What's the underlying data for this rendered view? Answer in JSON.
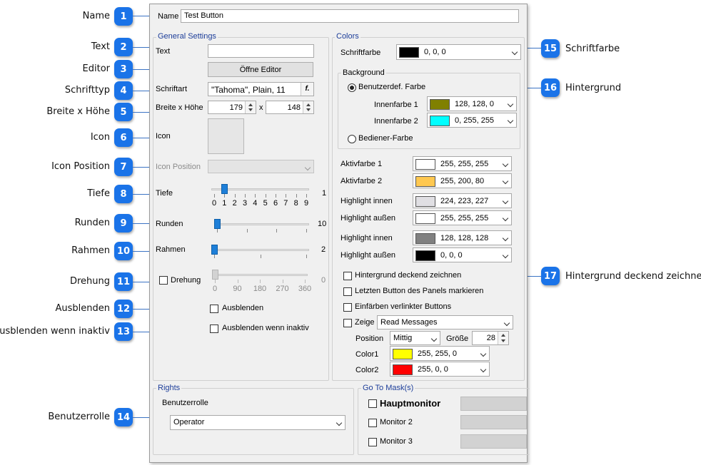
{
  "callouts": [
    {
      "num": "1",
      "label": "Name"
    },
    {
      "num": "2",
      "label": "Text"
    },
    {
      "num": "3",
      "label": "Editor"
    },
    {
      "num": "4",
      "label": "Schrifttyp"
    },
    {
      "num": "5",
      "label": "Breite x Höhe"
    },
    {
      "num": "6",
      "label": "Icon"
    },
    {
      "num": "7",
      "label": "Icon Position"
    },
    {
      "num": "8",
      "label": "Tiefe"
    },
    {
      "num": "9",
      "label": "Runden"
    },
    {
      "num": "10",
      "label": "Rahmen"
    },
    {
      "num": "11",
      "label": "Drehung"
    },
    {
      "num": "12",
      "label": "Ausblenden"
    },
    {
      "num": "13",
      "label": "Ausblenden wenn inaktiv"
    },
    {
      "num": "14",
      "label": "Benutzerrolle"
    },
    {
      "num": "15",
      "label": "Schriftfarbe"
    },
    {
      "num": "16",
      "label": "Hintergrund"
    },
    {
      "num": "17",
      "label": "Hintergrund deckend zeichnen"
    }
  ],
  "name": {
    "label": "Name",
    "value": "Test Button"
  },
  "general": {
    "title": "General Settings",
    "text_label": "Text",
    "text_value": "",
    "editor_button": "Öffne Editor",
    "font_label": "Schriftart",
    "font_value": "\"Tahoma\", Plain, 11",
    "font_btn": "f.",
    "size_label": "Breite x Höhe",
    "width": "179",
    "x": "x",
    "height": "148",
    "icon_label": "Icon",
    "icon_pos_label": "Icon Position",
    "icon_pos_value": "",
    "depth_label": "Tiefe",
    "depth": {
      "min": 0,
      "max": 9,
      "value": 1,
      "max_label": "1",
      "ticks": [
        "0",
        "1",
        "2",
        "3",
        "4",
        "5",
        "6",
        "7",
        "8",
        "9"
      ]
    },
    "round_label": "Runden",
    "round": {
      "min": 0,
      "max": 10,
      "value": 0,
      "max_label": "10"
    },
    "frame_label": "Rahmen",
    "frame": {
      "min": 0,
      "max": 2,
      "value": 0,
      "max_label": "2"
    },
    "rotation_label": "Drehung",
    "rotation": {
      "min": 0,
      "max": 360,
      "value": 0,
      "max_label": "0",
      "ticks": [
        "0",
        "90",
        "180",
        "270",
        "360"
      ]
    },
    "hide_label": "Ausblenden",
    "hide_inactive_label": "Ausblenden wenn inaktiv"
  },
  "colors": {
    "title": "Colors",
    "font_color_label": "Schriftfarbe",
    "font_color": {
      "hex": "#000000",
      "text": "0, 0, 0"
    },
    "background_title": "Background",
    "user_defined_label": "Benutzerdef. Farbe",
    "inner1_label": "Innenfarbe 1",
    "inner1": {
      "hex": "#808000",
      "text": "128, 128, 0"
    },
    "inner2_label": "Innenfarbe 2",
    "inner2": {
      "hex": "#00ffff",
      "text": "0, 255, 255"
    },
    "operator_color_label": "Bediener-Farbe",
    "active1_label": "Aktivfarbe 1",
    "active1": {
      "hex": "#ffffff",
      "text": "255, 255, 255"
    },
    "active2_label": "Aktivfarbe 2",
    "active2": {
      "hex": "#ffc850",
      "text": "255, 200, 80"
    },
    "hl_inner_a_label": "Highlight innen",
    "hl_inner_a": {
      "hex": "#e0dfe3",
      "text": "224, 223, 227"
    },
    "hl_outer_a_label": "Highlight außen",
    "hl_outer_a": {
      "hex": "#ffffff",
      "text": "255, 255, 255"
    },
    "hl_inner_b_label": "Highlight innen",
    "hl_inner_b": {
      "hex": "#808080",
      "text": "128, 128, 128"
    },
    "hl_outer_b_label": "Highlight außen",
    "hl_outer_b": {
      "hex": "#000000",
      "text": "0, 0, 0"
    },
    "opaque_label": "Hintergrund deckend zeichnen",
    "mark_last_label": "Letzten Button des Panels markieren",
    "tint_linked_label": "Einfärben verlinkter Buttons",
    "show_label": "Zeige",
    "show_value": "Read Messages",
    "position_label": "Position",
    "position_value": "Mittig",
    "size_label": "Größe",
    "size_value": "28",
    "color1_label": "Color1",
    "color1": {
      "hex": "#ffff00",
      "text": "255, 255, 0"
    },
    "color2_label": "Color2",
    "color2": {
      "hex": "#ff0000",
      "text": "255, 0, 0"
    }
  },
  "rights": {
    "title": "Rights",
    "role_label": "Benutzerrolle",
    "role_value": "Operator"
  },
  "goto": {
    "title": "Go To Mask(s)",
    "main_monitor": "Hauptmonitor",
    "monitor2": "Monitor 2",
    "monitor3": "Monitor 3"
  }
}
